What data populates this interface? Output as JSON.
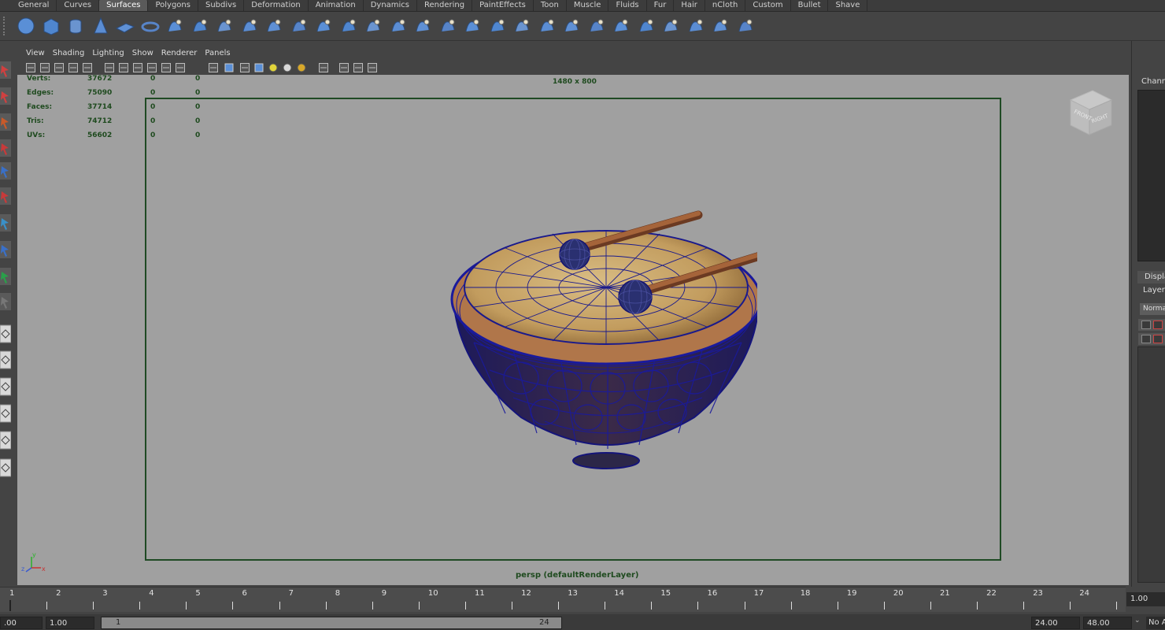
{
  "shelf": {
    "tabs": [
      {
        "label": "General"
      },
      {
        "label": "Curves"
      },
      {
        "label": "Surfaces",
        "active": true
      },
      {
        "label": "Polygons"
      },
      {
        "label": "Subdivs"
      },
      {
        "label": "Deformation"
      },
      {
        "label": "Animation"
      },
      {
        "label": "Dynamics"
      },
      {
        "label": "Rendering"
      },
      {
        "label": "PaintEffects"
      },
      {
        "label": "Toon"
      },
      {
        "label": "Muscle"
      },
      {
        "label": "Fluids"
      },
      {
        "label": "Fur"
      },
      {
        "label": "Hair"
      },
      {
        "label": "nCloth"
      },
      {
        "label": "Custom"
      },
      {
        "label": "Bullet"
      },
      {
        "label": "Shave"
      }
    ],
    "icons": [
      "nurbs-sphere-icon",
      "nurbs-cube-icon",
      "nurbs-cylinder-icon",
      "nurbs-cone-icon",
      "nurbs-plane-icon",
      "nurbs-torus-icon",
      "revolve-icon",
      "loft-icon",
      "planar-icon",
      "extrude-icon",
      "birail-icon",
      "boundary-icon",
      "square-icon",
      "bevel-icon",
      "bevel-plus-icon",
      "intersect-icon",
      "project-curve-icon",
      "trim-icon",
      "untrim-icon",
      "attach-icon",
      "detach-icon",
      "align-icon",
      "open-close-icon",
      "insert-isoparm-icon",
      "extend-icon",
      "offset-icon",
      "rebuild-icon",
      "reverse-icon",
      "sculpt-icon",
      "surface-edit-icon"
    ]
  },
  "toolbox": {
    "tools": [
      "select-tool-icon",
      "lasso-tool-icon",
      "paint-select-icon",
      "move-tool-icon",
      "rotate-tool-icon",
      "scale-tool-icon",
      "universal-manip-icon",
      "soft-mod-icon",
      "show-manip-icon",
      "last-tool-icon",
      "layout-single-icon",
      "layout-four-icon",
      "layout-persp-outliner-icon",
      "layout-persp-graph-icon",
      "layout-hypershade-icon",
      "layout-outliner-icon"
    ]
  },
  "panel": {
    "menus": [
      "View",
      "Shading",
      "Lighting",
      "Show",
      "Renderer",
      "Panels"
    ],
    "toolbar_icons": [
      "camera-select-icon",
      "camera-attributes-icon",
      "bookmarks-icon",
      "image-plane-icon",
      "grid-icon",
      "film-gate-icon",
      "resolution-gate-icon",
      "gate-mask-icon",
      "field-chart-icon",
      "safe-action-icon",
      "safe-title-icon",
      "wireframe-icon",
      "smooth-shade-icon",
      "wireframe-on-shaded-icon",
      "textured-icon",
      "default-lighting-icon",
      "all-lights-icon",
      "shadows-icon",
      "isolate-select-icon",
      "xray-icon",
      "xray-joints-icon",
      "xray-components-icon"
    ]
  },
  "viewport": {
    "resolution": "1480 x 800",
    "camera": "persp (defaultRenderLayer)",
    "hud": [
      {
        "label": "Verts:",
        "v1": "37672",
        "v2": "0",
        "v3": "0"
      },
      {
        "label": "Edges:",
        "v1": "75090",
        "v2": "0",
        "v3": "0"
      },
      {
        "label": "Faces:",
        "v1": "37714",
        "v2": "0",
        "v3": "0"
      },
      {
        "label": "Tris:",
        "v1": "74712",
        "v2": "0",
        "v3": "0"
      },
      {
        "label": "UVs:",
        "v1": "56602",
        "v2": "0",
        "v3": "0"
      }
    ],
    "view_cube": {
      "front": "FRONT",
      "right": "RIGHT"
    },
    "axes": {
      "x": "x",
      "y": "y",
      "z": "z"
    }
  },
  "channel_box": {
    "title": "Channe",
    "display_tab": "Display",
    "layers_menu": "Layers",
    "blend_mode": "Normal"
  },
  "time_slider": {
    "ticks": [
      "1",
      "2",
      "3",
      "4",
      "5",
      "6",
      "7",
      "8",
      "9",
      "10",
      "11",
      "12",
      "13",
      "14",
      "15",
      "16",
      "17",
      "18",
      "19",
      "20",
      "21",
      "22",
      "23",
      "24"
    ],
    "current_time": "1.00"
  },
  "range_slider": {
    "anim_start": ".00",
    "playback_start": "1.00",
    "range_start_label": "1",
    "range_end_label": "24",
    "playback_end": "24.00",
    "anim_end": "48.00",
    "anim_layer": "No Anim Layer"
  },
  "colors": {
    "background": "#444444",
    "viewport_bg": "#a0a0a0",
    "hud_text": "#1e4a1e",
    "wireframe": "#1a1a8c",
    "drum_skin": "#c8a66a"
  }
}
